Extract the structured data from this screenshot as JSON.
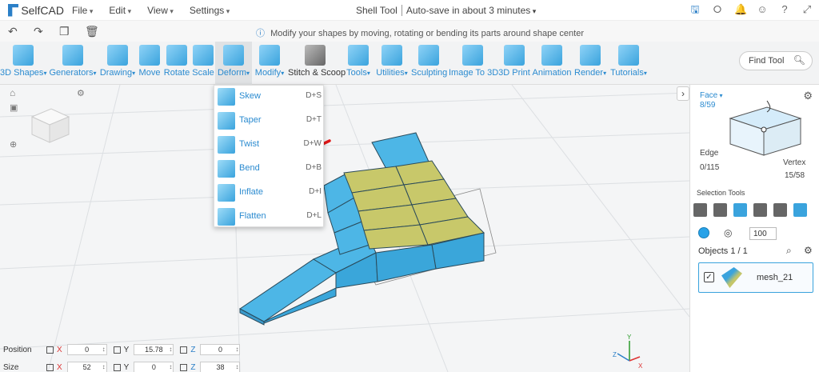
{
  "app": {
    "logo_text": "SelfCAD",
    "menus": [
      "File",
      "Edit",
      "View",
      "Settings"
    ],
    "title": "Shell Tool",
    "autosave": "Auto-save in about 3 minutes"
  },
  "hint": "Modify your shapes by moving, rotating or bending its parts around shape center",
  "toolbar": {
    "tools": [
      {
        "label": "3D Shapes",
        "dropdown": true
      },
      {
        "label": "Generators",
        "dropdown": true
      },
      {
        "label": "Drawing",
        "dropdown": true
      },
      {
        "label": "Move",
        "dropdown": false
      },
      {
        "label": "Rotate",
        "dropdown": false
      },
      {
        "label": "Scale",
        "dropdown": false
      },
      {
        "label": "Deform",
        "dropdown": true
      },
      {
        "label": "Modify",
        "dropdown": true
      },
      {
        "label": "Stitch & Scoop",
        "dropdown": false
      },
      {
        "label": "Tools",
        "dropdown": true
      },
      {
        "label": "Utilities",
        "dropdown": true
      },
      {
        "label": "Sculpting",
        "dropdown": false
      },
      {
        "label": "Image To 3D",
        "dropdown": false
      },
      {
        "label": "3D Print",
        "dropdown": false
      },
      {
        "label": "Animation",
        "dropdown": false
      },
      {
        "label": "Render",
        "dropdown": true
      },
      {
        "label": "Tutorials",
        "dropdown": true
      }
    ],
    "find_tool": "Find Tool"
  },
  "deform_menu": [
    {
      "label": "Skew",
      "shortcut": "D+S"
    },
    {
      "label": "Taper",
      "shortcut": "D+T"
    },
    {
      "label": "Twist",
      "shortcut": "D+W"
    },
    {
      "label": "Bend",
      "shortcut": "D+B"
    },
    {
      "label": "Inflate",
      "shortcut": "D+I"
    },
    {
      "label": "Flatten",
      "shortcut": "D+L"
    }
  ],
  "right_panel": {
    "face_label": "Face",
    "face_count": "8/59",
    "edge_label": "Edge",
    "edge_count": "0/115",
    "vertex_label": "Vertex",
    "vertex_count": "15/58",
    "selection_tools_label": "Selection Tools",
    "brush_size": "100",
    "objects_label": "Objects 1 / 1",
    "object_name": "mesh_21"
  },
  "transform": {
    "position_label": "Position",
    "size_label": "Size",
    "position": {
      "x": "0",
      "y": "15.78",
      "z": "0"
    },
    "size": {
      "x": "52",
      "y": "0",
      "z": "38"
    }
  },
  "colors": {
    "accent": "#2b8bd0",
    "mesh_blue": "#4db6e6",
    "mesh_selected": "#c8c86a",
    "arrow_red": "#e01818"
  }
}
